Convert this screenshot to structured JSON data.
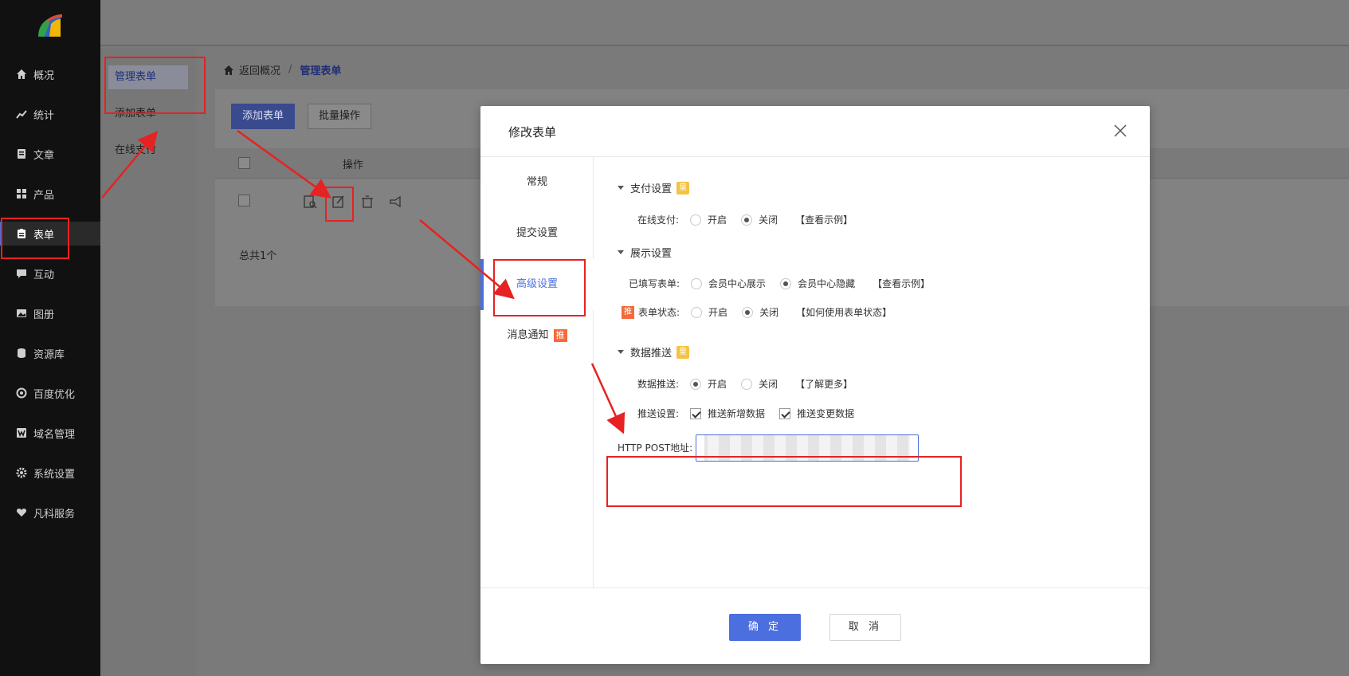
{
  "sidebar": {
    "items": [
      {
        "label": "概况",
        "icon": "home-icon"
      },
      {
        "label": "统计",
        "icon": "stats-icon"
      },
      {
        "label": "文章",
        "icon": "article-icon"
      },
      {
        "label": "产品",
        "icon": "grid-icon"
      },
      {
        "label": "表单",
        "icon": "clipboard-icon"
      },
      {
        "label": "互动",
        "icon": "chat-icon"
      },
      {
        "label": "图册",
        "icon": "image-icon"
      },
      {
        "label": "资源库",
        "icon": "database-icon"
      },
      {
        "label": "百度优化",
        "icon": "target-icon"
      },
      {
        "label": "域名管理",
        "icon": "domain-icon"
      },
      {
        "label": "系统设置",
        "icon": "gear-icon"
      },
      {
        "label": "凡科服务",
        "icon": "heart-icon"
      }
    ]
  },
  "submenu": {
    "items": [
      "管理表单",
      "添加表单",
      "在线支付"
    ]
  },
  "breadcrumb": {
    "back": "返回概况",
    "separator": "/",
    "current": "管理表单"
  },
  "toolbar": {
    "add_label": "添加表单",
    "batch_label": "批量操作"
  },
  "table": {
    "header_op": "操作",
    "total": "总共1个"
  },
  "modal": {
    "title": "修改表单",
    "tabs": [
      "常规",
      "提交设置",
      "高级设置",
      "消息通知"
    ],
    "tab_badge": "推",
    "sections": {
      "payment": {
        "title": "支付设置",
        "badge": "皇",
        "online_pay_label": "在线支付:",
        "opt_on": "开启",
        "opt_off": "关闭",
        "help": "【查看示例】"
      },
      "display": {
        "title": "展示设置",
        "filled_label": "已填写表单:",
        "opt_show": "会员中心展示",
        "opt_hide": "会员中心隐藏",
        "help": "【查看示例】",
        "status_badge": "推",
        "status_label": "表单状态:",
        "opt_on": "开启",
        "opt_off": "关闭",
        "status_help": "【如何使用表单状态】"
      },
      "push": {
        "title": "数据推送",
        "badge": "皇",
        "push_label": "数据推送:",
        "opt_on": "开启",
        "opt_off": "关闭",
        "help": "【了解更多】",
        "settings_label": "推送设置:",
        "opt_new": "推送新增数据",
        "opt_change": "推送变更数据",
        "url_label": "HTTP POST地址:"
      }
    },
    "ok_label": "确 定",
    "cancel_label": "取 消"
  },
  "colors": {
    "accent": "#4c6fe0",
    "annotation": "#e62222",
    "vip": "#f5c342",
    "push": "#f46a3a"
  }
}
